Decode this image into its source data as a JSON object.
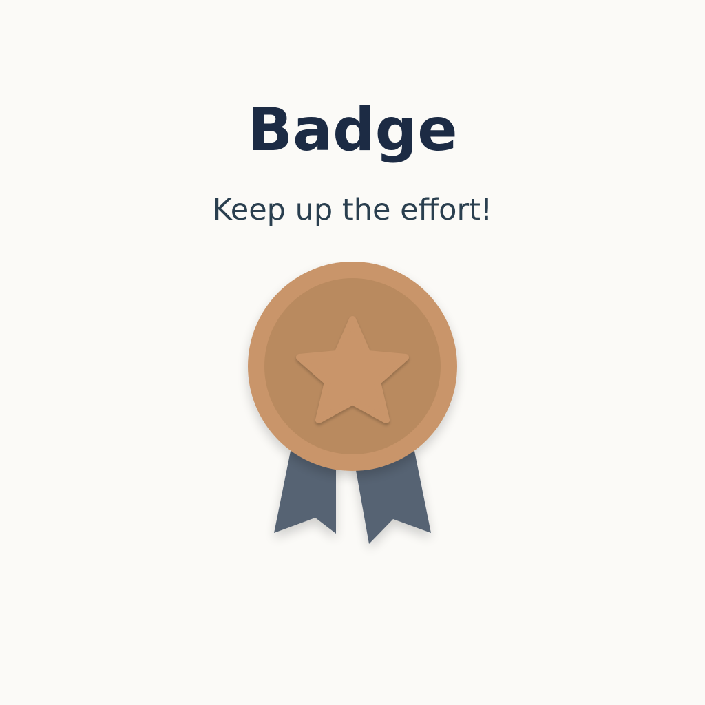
{
  "screen": {
    "title": "Badge",
    "message": "Keep up the effort!"
  },
  "badge": {
    "icon": "star-icon",
    "tier_color": "#c9956a",
    "ribbon_color": "#566373"
  },
  "colors": {
    "background": "#fbfaf7",
    "title": "#1c2b44",
    "message": "#2a3f4f"
  }
}
